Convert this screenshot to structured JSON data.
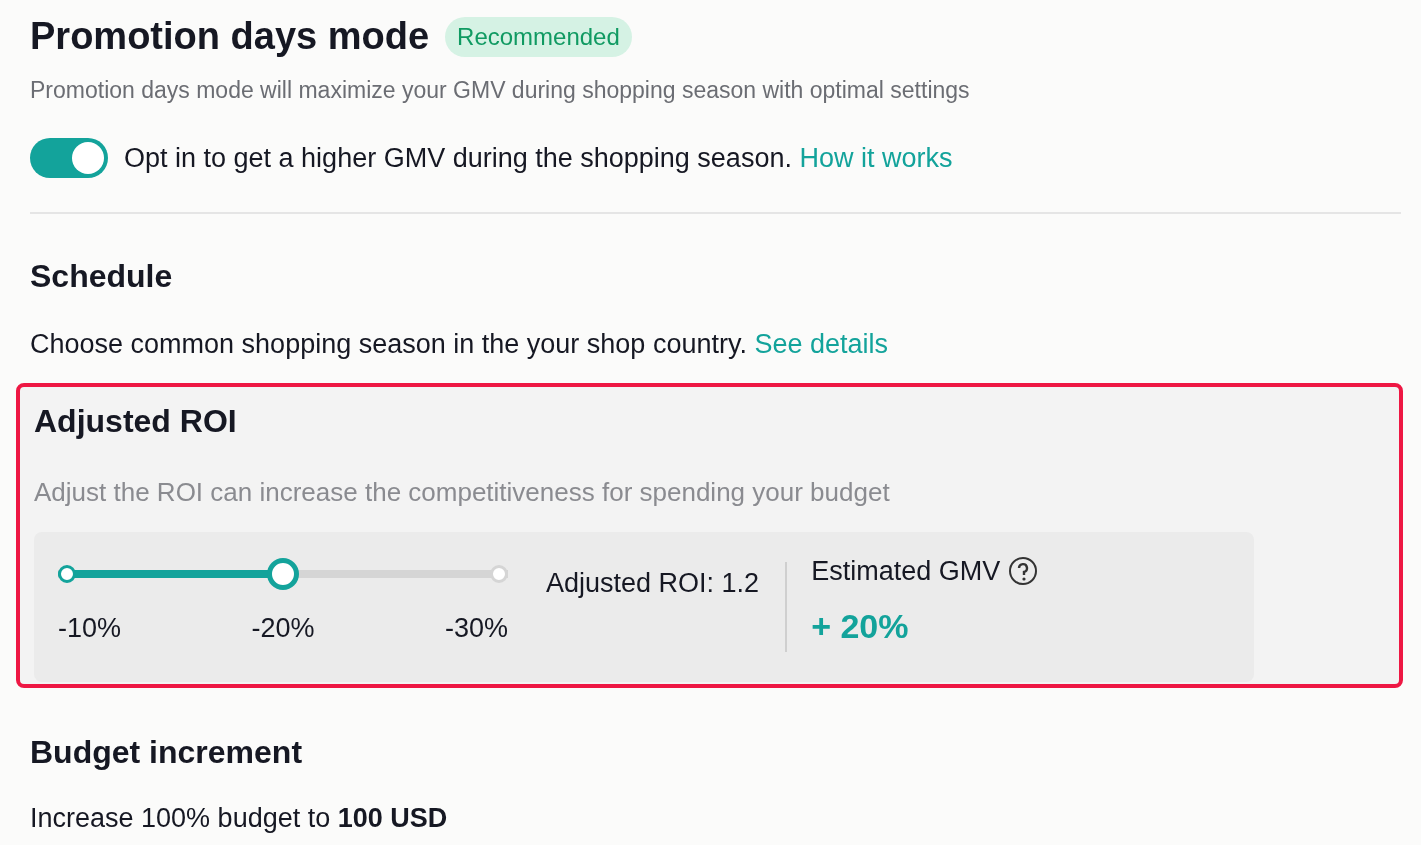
{
  "header": {
    "title": "Promotion days mode",
    "badge": "Recommended",
    "description": "Promotion days mode will maximize your GMV during shopping season with optimal settings"
  },
  "opt_in": {
    "on": true,
    "text": "Opt in to get a higher GMV during the shopping season.",
    "link": "How it works"
  },
  "schedule": {
    "title": "Schedule",
    "text": "Choose common shopping season in the your shop country.",
    "link": "See details"
  },
  "adjusted_roi": {
    "highlighted": true,
    "title": "Adjusted ROI",
    "description": "Adjust the ROI can increase the competitiveness for spending your budget",
    "slider": {
      "level": 0.5,
      "stops": [
        "-10%",
        "-20%",
        "-30%"
      ]
    },
    "reading": "Adjusted ROI: 1.2",
    "estimate_label": "Estimated GMV",
    "estimate_value": "+ 20%"
  },
  "budget": {
    "title": "Budget increment",
    "text": "Increase 100% budget to **100 USD**"
  }
}
